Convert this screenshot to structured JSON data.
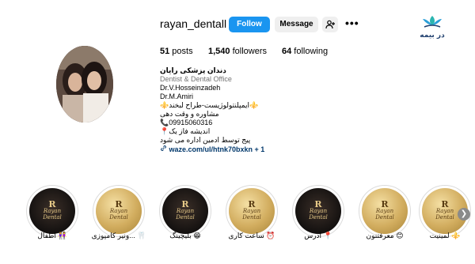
{
  "brand": {
    "logo_text": "در بیمه",
    "icon": "lotus-tooth-icon"
  },
  "profile": {
    "username": "rayan_dentall",
    "follow_label": "Follow",
    "message_label": "Message",
    "add_user_icon": "add-user-icon",
    "more_label": "•••"
  },
  "stats": {
    "posts_count": "51",
    "posts_label": " posts",
    "followers_count": "1,540",
    "followers_label": " followers",
    "following_count": "64",
    "following_label": " following"
  },
  "bio": {
    "name": "دندان پزشکی رایان",
    "category": "Dentist & Dental Office",
    "lines": [
      "Dr.V.Hosseinzadeh",
      "Dr.M.Amiri",
      "⚜️ایمپلنتولوژیست-طراح لبخند⚜️",
      "مشاوره و وقت دهی",
      "📞09915060316",
      "📍اندیشه فاز یک",
      "پیج توسط ادمین اداره می شود"
    ],
    "link": "waze.com/ul/htnk70bxkn + 1",
    "link_icon": "link-icon"
  },
  "highlights": [
    {
      "label": "اطفال 👭",
      "style": "dark"
    },
    {
      "label": "ونیر کامپوزی... 🦷",
      "style": "gold"
    },
    {
      "label": "بلیچینگ 😁",
      "style": "dark"
    },
    {
      "label": "ساعت کاری ⏰",
      "style": "gold"
    },
    {
      "label": "آدرس 📍",
      "style": "dark"
    },
    {
      "label": "معرفتنون 😊",
      "style": "gold"
    },
    {
      "label": "لمینیت ⚜️",
      "style": "gold"
    }
  ],
  "highlight_logo": {
    "mono": "R",
    "line1": "Rayan",
    "line2": "Dental"
  },
  "next_icon": "chevron-right-icon",
  "colors": {
    "follow": "#1a95f0",
    "link": "#00376b",
    "brand": "#1f3f6e"
  }
}
